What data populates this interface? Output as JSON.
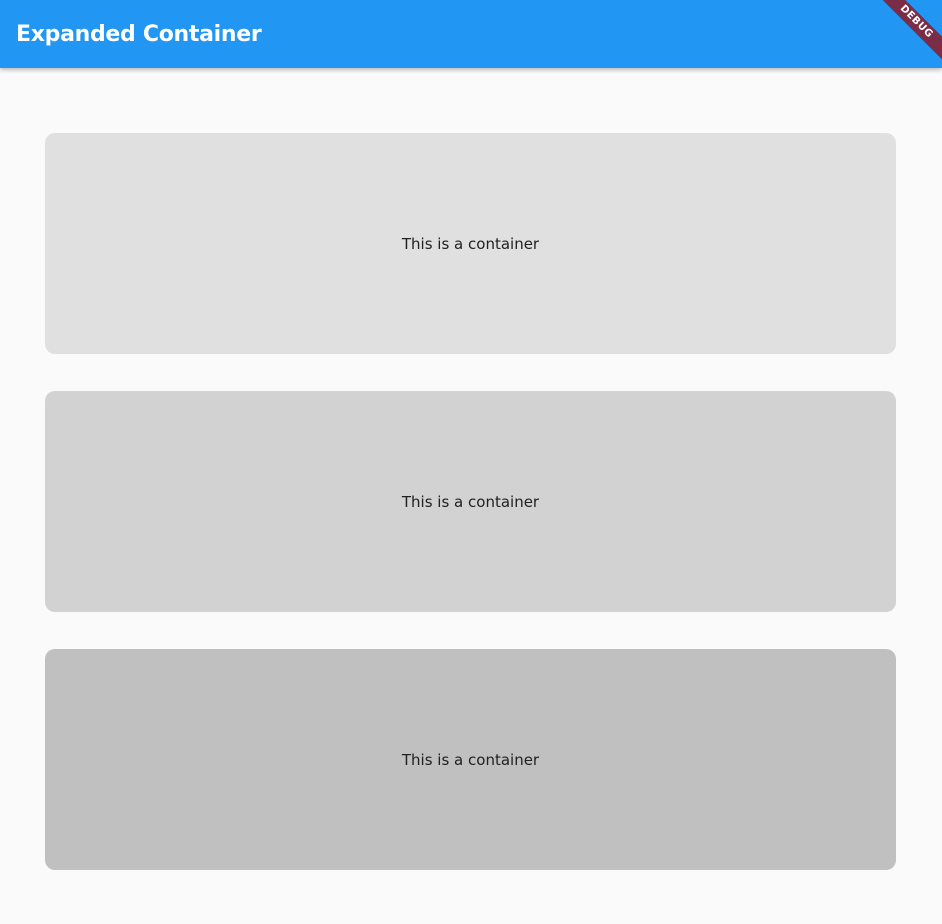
{
  "app_bar": {
    "title": "Expanded Container",
    "background_color": "#2196f3"
  },
  "debug_banner": {
    "label": "DEBUG",
    "color": "#7b2c46"
  },
  "containers": [
    {
      "label": "This is a container",
      "color": "#e0e0e0"
    },
    {
      "label": "This is a container",
      "color": "#d2d2d2"
    },
    {
      "label": "This is a container",
      "color": "#c0c0c0"
    }
  ],
  "page_background": "#fafafa"
}
